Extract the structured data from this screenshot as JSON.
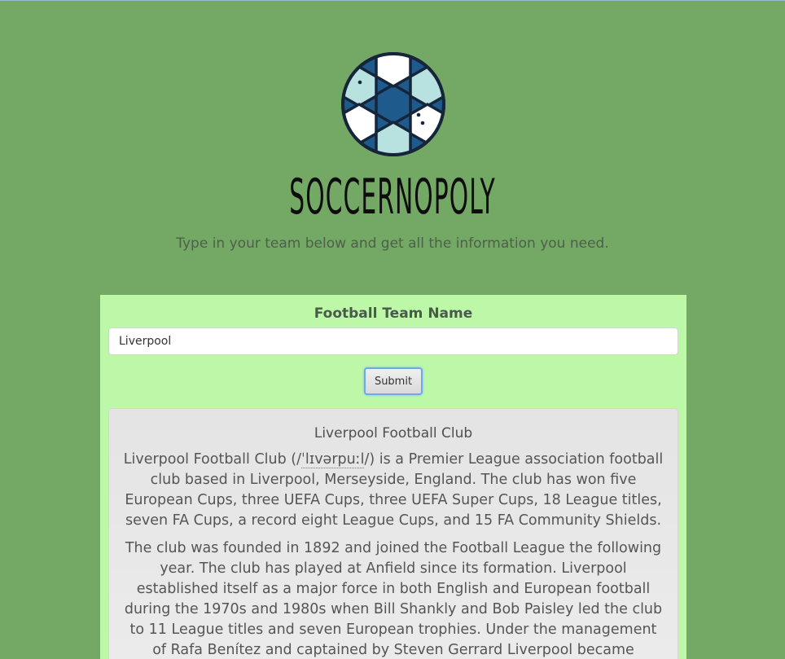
{
  "header": {
    "title": "SOCCERNOPOLY",
    "subtitle": "Type in your team below and get all the information you need."
  },
  "form": {
    "label": "Football Team Name",
    "input_value": "Liverpool",
    "submit_label": "Submit"
  },
  "result": {
    "heading": "Liverpool Football Club",
    "para1_lead": "Liverpool Football Club (/",
    "para1_ipa": "ˈlɪvərpuːl",
    "para1_rest": "/) is a Premier League association football club based in Liverpool, Merseyside, England. The club has won five European Cups, three UEFA Cups, three UEFA Super Cups, 18 League titles, seven FA Cups, a record eight League Cups, and 15 FA Community Shields.",
    "para2": "The club was founded in 1892 and joined the Football League the following year. The club has played at Anfield since its formation. Liverpool established itself as a major force in both English and European football during the 1970s and 1980s when Bill Shankly and Bob Paisley led the club to 11 League titles and seven European trophies. Under the management of Rafa Benítez and captained by Steven Gerrard Liverpool became European champion for the fifth"
  },
  "colors": {
    "background": "#74a865",
    "card": "#bdf8a9",
    "ball_dark": "#1f5a8c",
    "ball_light": "#b8e2e0"
  },
  "icons": {
    "logo": "soccer-ball-icon"
  }
}
